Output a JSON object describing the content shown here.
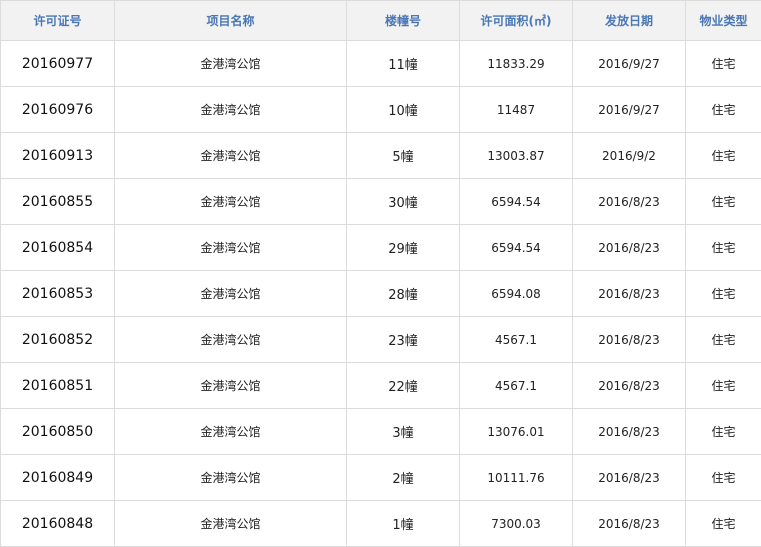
{
  "table": {
    "headers": [
      "许可证号",
      "项目名称",
      "楼幢号",
      "许可面积(㎡)",
      "发放日期",
      "物业类型"
    ],
    "rows": [
      [
        "20160977",
        "金港湾公馆",
        "11幢",
        "11833.29",
        "2016/9/27",
        "住宅"
      ],
      [
        "20160976",
        "金港湾公馆",
        "10幢",
        "11487",
        "2016/9/27",
        "住宅"
      ],
      [
        "20160913",
        "金港湾公馆",
        "5幢",
        "13003.87",
        "2016/9/2",
        "住宅"
      ],
      [
        "20160855",
        "金港湾公馆",
        "30幢",
        "6594.54",
        "2016/8/23",
        "住宅"
      ],
      [
        "20160854",
        "金港湾公馆",
        "29幢",
        "6594.54",
        "2016/8/23",
        "住宅"
      ],
      [
        "20160853",
        "金港湾公馆",
        "28幢",
        "6594.08",
        "2016/8/23",
        "住宅"
      ],
      [
        "20160852",
        "金港湾公馆",
        "23幢",
        "4567.1",
        "2016/8/23",
        "住宅"
      ],
      [
        "20160851",
        "金港湾公馆",
        "22幢",
        "4567.1",
        "2016/8/23",
        "住宅"
      ],
      [
        "20160850",
        "金港湾公馆",
        "3幢",
        "13076.01",
        "2016/8/23",
        "住宅"
      ],
      [
        "20160849",
        "金港湾公馆",
        "2幢",
        "10111.76",
        "2016/8/23",
        "住宅"
      ],
      [
        "20160848",
        "金港湾公馆",
        "1幢",
        "7300.03",
        "2016/8/23",
        "住宅"
      ]
    ]
  },
  "colors": {
    "header_text": "#4a78b5",
    "header_bg": "#f2f2f2",
    "border": "#dcdcdc"
  }
}
